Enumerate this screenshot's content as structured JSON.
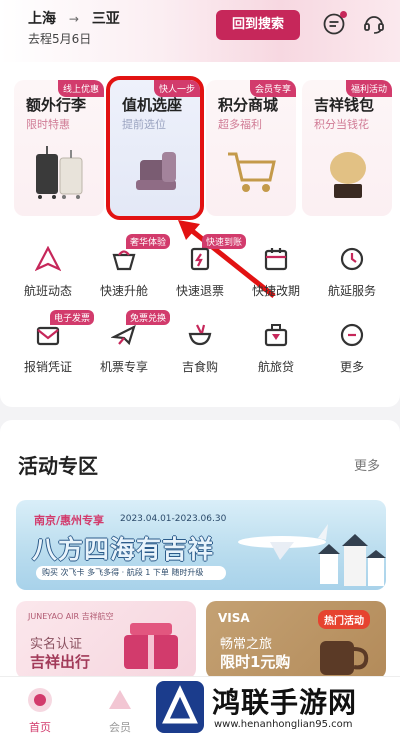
{
  "header": {
    "origin": "上海",
    "destination": "三亚",
    "route_arrow": "→",
    "trip_date": "去程5月6日",
    "back_button": "回到搜索",
    "icons": [
      "message-icon",
      "customer-service-icon"
    ],
    "accent_color": "#c6275a"
  },
  "quick_cards": [
    {
      "title": "额外行李",
      "subtitle": "限时特惠",
      "badge": "线上优惠"
    },
    {
      "title": "值机选座",
      "subtitle": "提前选位",
      "badge": "快人一步"
    },
    {
      "title": "积分商城",
      "subtitle": "超多福利",
      "badge": "会员专享"
    },
    {
      "title": "吉祥钱包",
      "subtitle": "积分当钱花",
      "badge": "福利活动"
    }
  ],
  "services": [
    {
      "label": "航班动态",
      "tag": ""
    },
    {
      "label": "快速升舱",
      "tag": "奢华体验"
    },
    {
      "label": "快速退票",
      "tag": "快速到账"
    },
    {
      "label": "快捷改期",
      "tag": ""
    },
    {
      "label": "航延服务",
      "tag": ""
    },
    {
      "label": "报销凭证",
      "tag": "电子发票"
    },
    {
      "label": "机票专享",
      "tag": "免票兑换"
    },
    {
      "label": "吉食购",
      "tag": ""
    },
    {
      "label": "航旅贷",
      "tag": ""
    },
    {
      "label": "更多",
      "tag": ""
    }
  ],
  "activity": {
    "title": "活动专区",
    "more": "更多",
    "banner": {
      "tag": "南京/惠州专享",
      "date": "2023.04.01-2023.06.30",
      "headline": "八方四海有吉祥",
      "footer": "购买 次飞卡 多飞多得 · 航段 1 下单 随时升级"
    },
    "tile_left": {
      "brand": "JUNEYAO AIR 吉祥航空",
      "line1": "实名认证",
      "line2": "吉祥出行"
    },
    "tile_right": {
      "brand": "VISA",
      "line1": "畅常之旅",
      "line2": "限时1元购"
    },
    "hot_badge": "热门活动"
  },
  "tabbar": [
    {
      "label": "首页",
      "active": true
    },
    {
      "label": "会员",
      "active": false
    }
  ],
  "watermark": {
    "title": "鸿联手游网",
    "url": "www.henanhonglian95.com"
  }
}
